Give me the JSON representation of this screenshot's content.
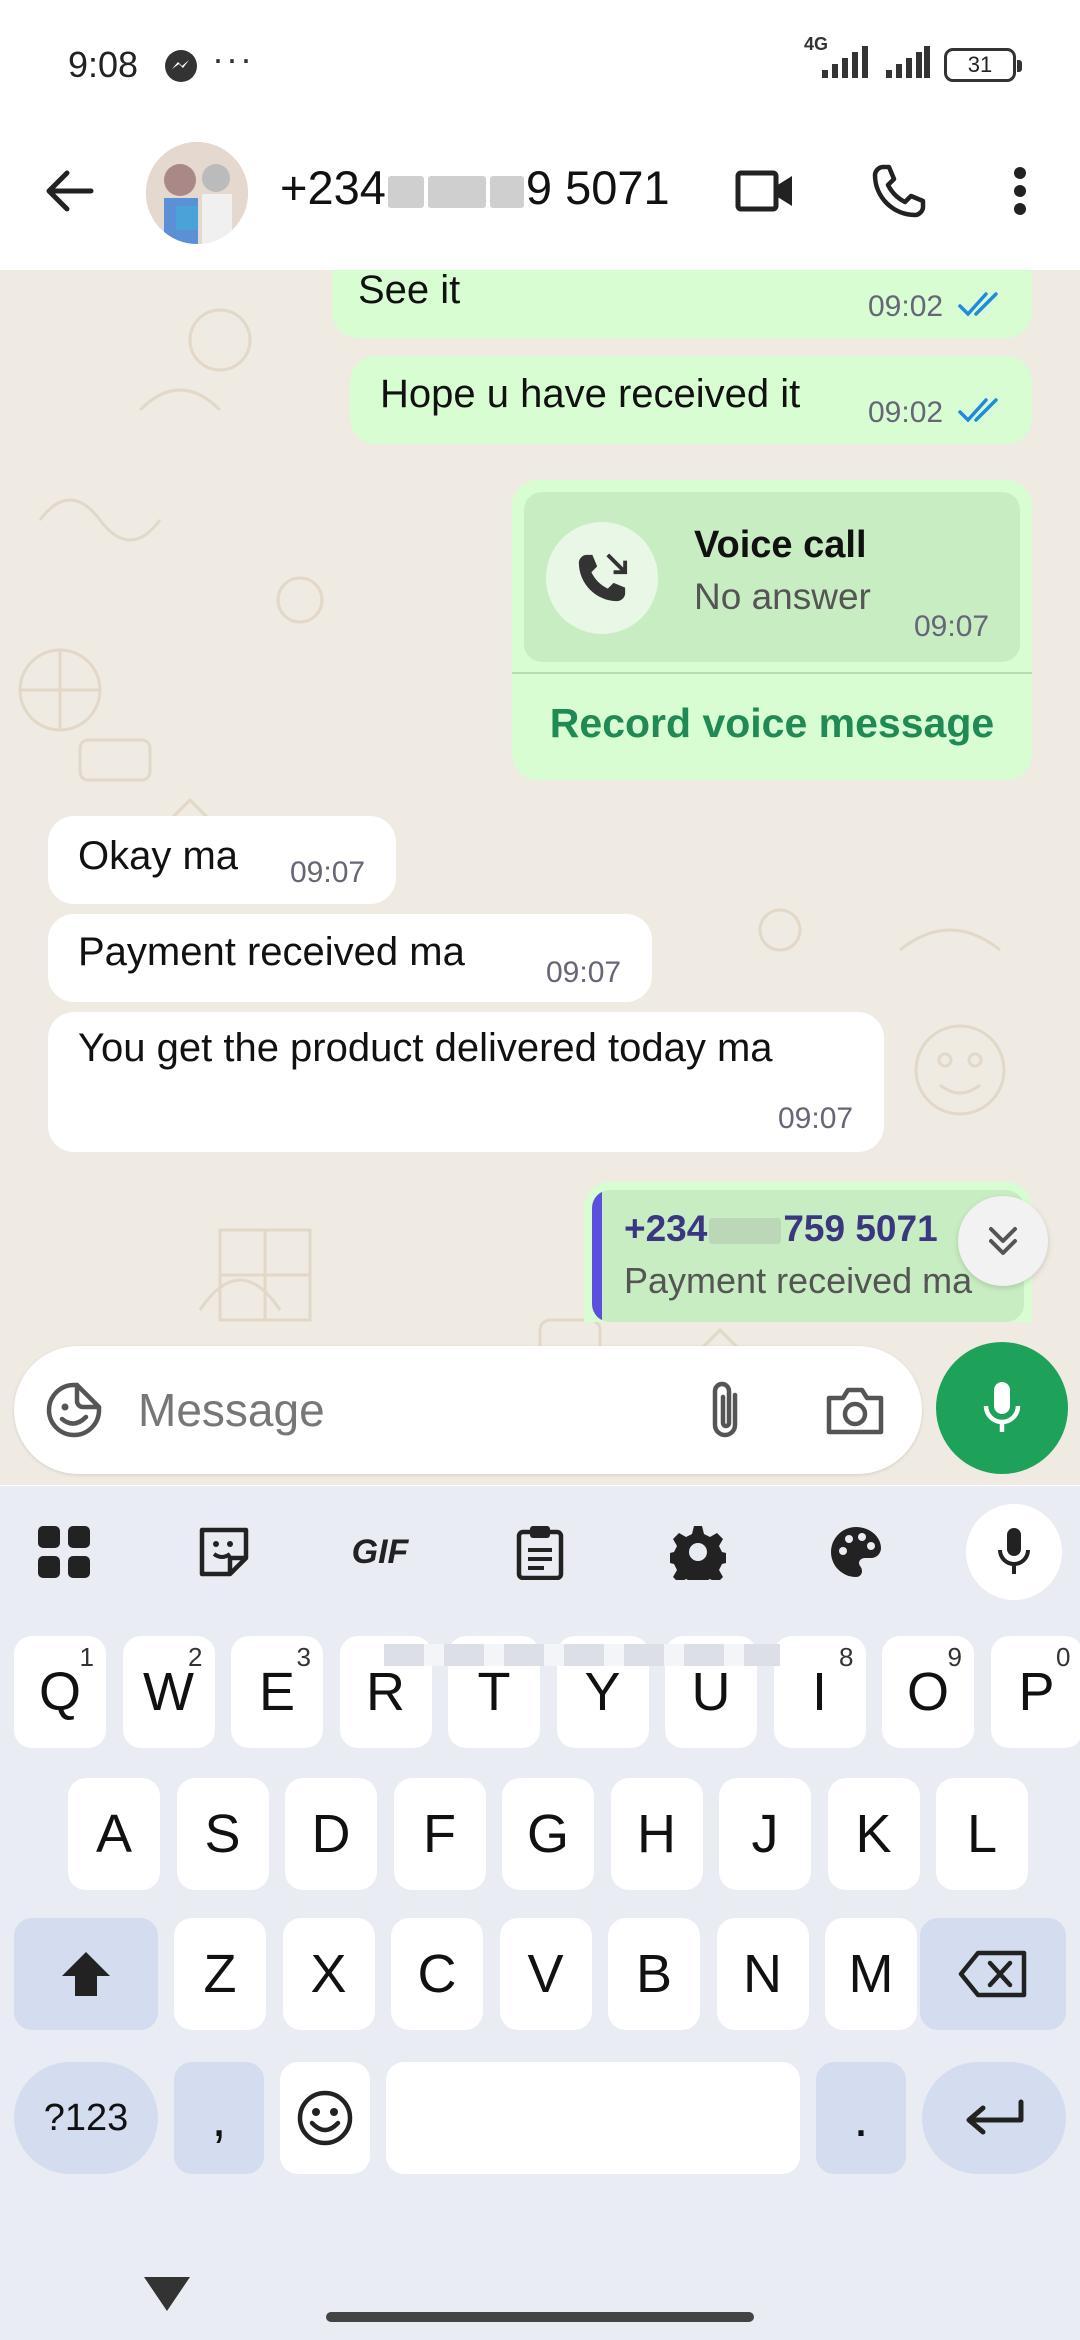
{
  "status_bar": {
    "time": "9:08",
    "dots": "···",
    "network": "4G",
    "battery": "31"
  },
  "header": {
    "contact_prefix": "+234",
    "contact_suffix": "9 5071"
  },
  "messages": {
    "seeit": {
      "text": "See it",
      "time": "09:02"
    },
    "hope": {
      "text": "Hope u have received it",
      "time": "09:02"
    },
    "call": {
      "title": "Voice call",
      "status": "No answer",
      "time": "09:07",
      "action": "Record voice message"
    },
    "okay": {
      "text": "Okay ma",
      "time": "09:07"
    },
    "payment": {
      "text": "Payment received ma",
      "time": "09:07"
    },
    "product": {
      "text": "You get the product delivered today ma",
      "time": "09:07"
    },
    "quote": {
      "name_prefix": "+234",
      "name_suffix": "759 5071",
      "text": "Payment received ma"
    }
  },
  "composer": {
    "placeholder": "Message"
  },
  "keyboard": {
    "toolbar": {
      "gif": "GIF"
    },
    "row1": [
      {
        "key": "Q",
        "hint": "1"
      },
      {
        "key": "W",
        "hint": "2"
      },
      {
        "key": "E",
        "hint": "3"
      },
      {
        "key": "R",
        "hint": ""
      },
      {
        "key": "T",
        "hint": ""
      },
      {
        "key": "Y",
        "hint": ""
      },
      {
        "key": "U",
        "hint": ""
      },
      {
        "key": "I",
        "hint": "8"
      },
      {
        "key": "O",
        "hint": "9"
      },
      {
        "key": "P",
        "hint": "0"
      }
    ],
    "row2": [
      "A",
      "S",
      "D",
      "F",
      "G",
      "H",
      "J",
      "K",
      "L"
    ],
    "row3": [
      "Z",
      "X",
      "C",
      "V",
      "B",
      "N",
      "M"
    ],
    "symbols": "?123",
    "comma": ",",
    "period": "."
  },
  "colors": {
    "outgoing_bubble": "#d9fdd3",
    "accent_green": "#1ea25a",
    "read_ticks": "#1d8be0",
    "chat_background": "#efeae2"
  },
  "icons": [
    "back-arrow-icon",
    "video-icon",
    "phone-icon",
    "more-vert-icon",
    "missed-call-icon",
    "double-chevron-down-icon",
    "sticker-icon",
    "paperclip-icon",
    "camera-icon",
    "mic-icon",
    "apps-grid-icon",
    "sticker-board-icon",
    "clipboard-icon",
    "gear-icon",
    "palette-icon",
    "shift-icon",
    "backspace-icon",
    "emoji-icon",
    "enter-icon",
    "chevron-down-icon"
  ]
}
